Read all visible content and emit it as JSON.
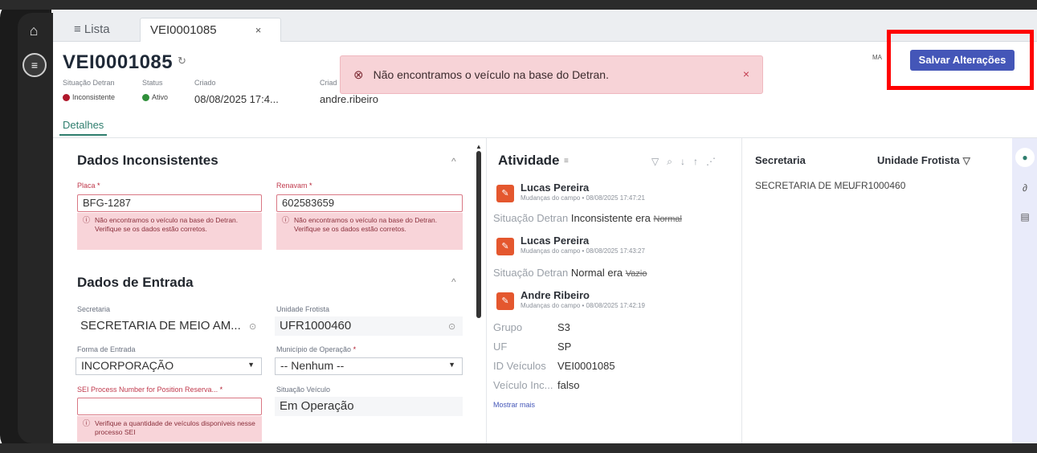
{
  "tabs": {
    "list_label": "≡ Lista",
    "record_tab_label": "VEI0001085",
    "close_glyph": "×"
  },
  "header": {
    "title": "VEI0001085",
    "meta": {
      "situacao_label": "Situação Detran",
      "situacao_value": "Inconsistente",
      "status_label": "Status",
      "status_value": "Ativo",
      "criado_label": "Criado",
      "criado_value": "08/08/2025 17:4...",
      "criado_por_label": "Criad",
      "criado_por_value": "andre.ribeiro"
    },
    "details_tab": "Detalhes",
    "ma_label": "MA",
    "save_label": "Salvar Alterações"
  },
  "toast": {
    "message": "Não encontramos o veículo na base do Detran.",
    "icon": "error-circle-icon",
    "close": "×"
  },
  "left": {
    "inconsistent_title": "Dados Inconsistentes",
    "placa_label": "Placa",
    "placa_value": "BFG-1287",
    "placa_error": "Não encontramos o veículo na base do Detran. Verifique se os dados estão corretos.",
    "renavam_label": "Renavam",
    "renavam_value": "602583659",
    "renavam_error": "Não encontramos o veículo na base do Detran. Verifique se os dados estão corretos.",
    "entrada_title": "Dados de Entrada",
    "secretaria_label": "Secretaria",
    "secretaria_value": "SECRETARIA DE MEIO AM...",
    "unidade_label": "Unidade Frotista",
    "unidade_value": "UFR1000460",
    "forma_label": "Forma de Entrada",
    "forma_value": "INCORPORAÇÃO",
    "municipio_label": "Município de Operação",
    "municipio_value": "-- Nenhum --",
    "sei_label": "SEI Process Number for Position Reserva...",
    "sei_value": "",
    "sei_error": "Verifique a quantidade de veículos disponíveis nesse processo SEI",
    "situacao_veiculo_label": "Situação Veículo",
    "situacao_veiculo_value": "Em Operação"
  },
  "activity": {
    "title": "Atividade",
    "items": [
      {
        "name": "Lucas Pereira",
        "sub": "Mudanças do campo • 08/08/2025 17:47:21",
        "field": "Situação Detran",
        "new": "Inconsistente era",
        "old": "Normal"
      },
      {
        "name": "Lucas Pereira",
        "sub": "Mudanças do campo • 08/08/2025 17:43:27",
        "field": "Situação Detran",
        "new": "Normal era",
        "old": "Vazio"
      },
      {
        "name": "Andre Ribeiro",
        "sub": "Mudanças do campo • 08/08/2025 17:42:19",
        "field": "",
        "new": "",
        "old": ""
      }
    ],
    "kv": [
      {
        "k": "Grupo",
        "v": "S3"
      },
      {
        "k": "UF",
        "v": "SP"
      },
      {
        "k": "ID Veículos",
        "v": "VEI0001085"
      },
      {
        "k": "Veículo Inc...",
        "v": "falso"
      }
    ],
    "show_more": "Mostrar mais"
  },
  "related": {
    "col1": "Secretaria",
    "col2": "Unidade Frotista",
    "row_col1": "SECRETARIA DE ME...",
    "row_col2": "UFR1000460"
  },
  "colors": {
    "accent": "#4456b8",
    "error_bg": "#f8d4d9",
    "highlight": "#ff0000",
    "tab_active": "#2e7d6d"
  }
}
